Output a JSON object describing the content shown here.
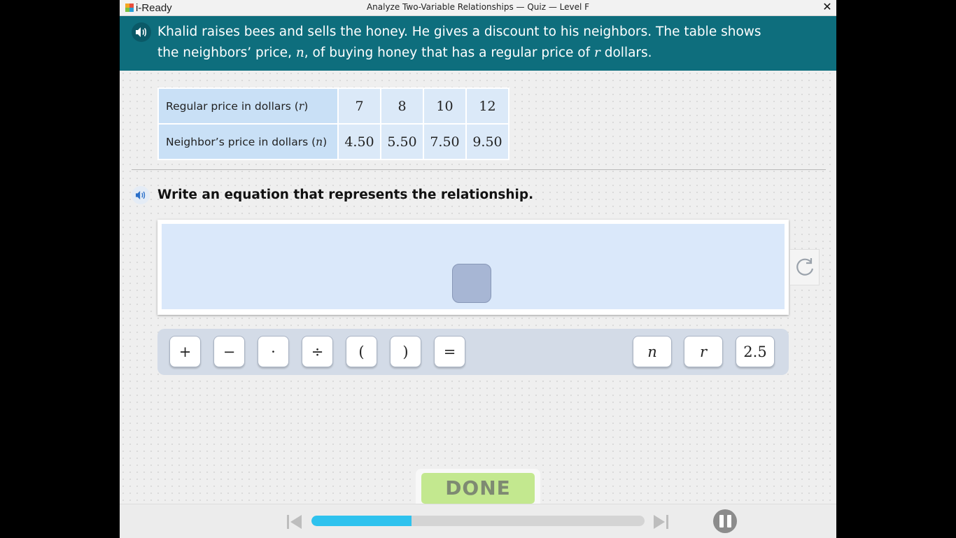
{
  "window": {
    "brand": "i-Ready",
    "title": "Analyze Two-Variable Relationships — Quiz — Level F",
    "close_label": "✕"
  },
  "problem": {
    "line1": "Khalid raises bees and sells the honey. He gives a discount to his neighbors. The table shows",
    "line2_a": "the neighbors’ price, ",
    "var_n": "n",
    "line2_b": ", of buying honey that has a regular price of ",
    "var_r": "r",
    "line2_c": " dollars."
  },
  "table": {
    "row1_label": "Regular price in dollars (",
    "row1_var": "r",
    "row2_label": "Neighbor’s price in dollars (",
    "row2_var": "n",
    "close_paren": ")",
    "regular": [
      "7",
      "8",
      "10",
      "12"
    ],
    "neighbor": [
      "4.50",
      "5.50",
      "7.50",
      "9.50"
    ]
  },
  "question": "Write an equation that represents the relationship.",
  "keypad": {
    "operators": [
      "+",
      "−",
      "·",
      "÷",
      "(",
      ")",
      "="
    ],
    "variables": [
      "n",
      "r"
    ],
    "number": "2.5"
  },
  "done_label": "DONE",
  "progress": {
    "fraction": 0.3
  },
  "colors": {
    "banner": "#0e6e7d",
    "answer_area": "#dae8fa",
    "done": "#c3e88f",
    "progress": "#2ec2ee"
  }
}
